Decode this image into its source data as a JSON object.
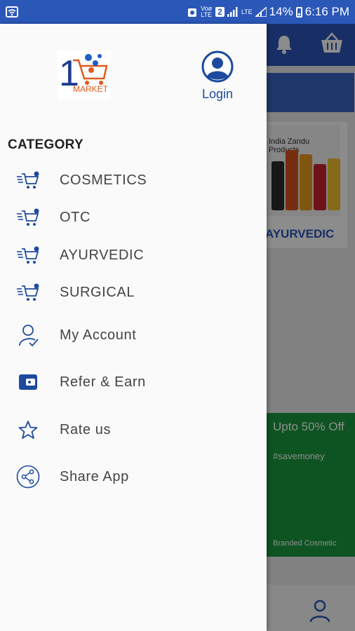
{
  "status_bar": {
    "network_badges": [
      "Voø LTE",
      "2",
      "LTE"
    ],
    "battery": "14%",
    "time": "6:16 PM"
  },
  "colors": {
    "primary_blue": "#2a57b8",
    "drawer_bg": "#fafafa",
    "promo_green": "#1a9a3e"
  },
  "drawer": {
    "logo_number": "1",
    "logo_text": "MARKET",
    "login_label": "Login",
    "category_heading": "CATEGORY",
    "categories": [
      {
        "label": "COSMETICS",
        "icon": "cart-icon"
      },
      {
        "label": "OTC",
        "icon": "cart-icon"
      },
      {
        "label": "AYURVEDIC",
        "icon": "cart-icon"
      },
      {
        "label": "SURGICAL",
        "icon": "cart-icon"
      }
    ],
    "menu": [
      {
        "label": "My Account",
        "icon": "user-check-icon"
      },
      {
        "label": "Refer & Earn",
        "icon": "wallet-icon"
      },
      {
        "label": "Rate us",
        "icon": "star-icon"
      },
      {
        "label": "Share App",
        "icon": "share-icon"
      }
    ]
  },
  "background": {
    "card_title": "India Zandu Products",
    "card_label": "AYURVEDIC",
    "promo_title": "Upto 50% Off",
    "promo_tag": "#savemoney",
    "promo_footer": "Branded Cosmetic"
  }
}
